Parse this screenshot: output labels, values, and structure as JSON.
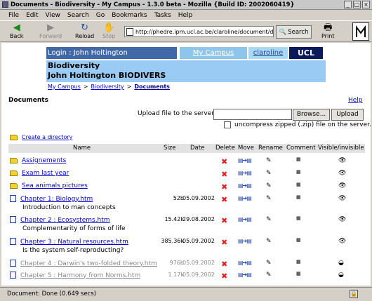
{
  "window": {
    "title": "Documents - Biodiversity - My Campus - 1.3.0 beta - Mozilla {Build ID: 2002060419}"
  },
  "menu": [
    "File",
    "Edit",
    "View",
    "Search",
    "Go",
    "Bookmarks",
    "Tasks",
    "Help"
  ],
  "toolbar": {
    "back": "Back",
    "forward": "Forward",
    "reload": "Reload",
    "stop": "Stop",
    "url": "http://phedre.ipm.ucl.ac.be/claroline/document/dc",
    "search": "Search",
    "print": "Print"
  },
  "banner": {
    "login": "Login : John Holtington",
    "campus": "My Campus",
    "claroline": "claroline",
    "ucl": "UCL"
  },
  "course": {
    "title": "Biodiversity",
    "subtitle": "John Holtington BIODIVERS"
  },
  "breadcrumb": [
    "My Campus",
    "Biodiversity",
    "Documents"
  ],
  "page": {
    "title": "Documents",
    "help": "Help"
  },
  "upload": {
    "label": "Upload file to the server :",
    "browse": "Browse...",
    "upload": "Upload",
    "uncompress": "uncompress zipped (.zip) file on the server."
  },
  "create_dir": "Create a directory",
  "table": {
    "headers": {
      "name": "Name",
      "size": "Size",
      "date": "Date",
      "delete": "Delete",
      "move": "Move",
      "rename": "Rename",
      "comment": "Comment",
      "visible": "Visible/invisible"
    },
    "rows": [
      {
        "name": "Assignements",
        "size": "",
        "date": "",
        "comment": ""
      },
      {
        "name": "Exam last year",
        "size": "",
        "date": "",
        "comment": ""
      },
      {
        "name": "Sea animals pictures",
        "size": "",
        "date": "",
        "comment": ""
      },
      {
        "name": "Chapter 1: Biology.htm",
        "size": "52b",
        "date": "05.09.2002",
        "comment": "Introduction to man concepts"
      },
      {
        "name": "Chapter 2 : Ecosystems.htm",
        "size": "15.42k",
        "date": "29.08.2002",
        "comment": "Complementarity of forms of life"
      },
      {
        "name": "Chapter 3 : Natural resources.htm",
        "size": "385.36k",
        "date": "05.09.2002",
        "comment": "Is the system self-reproducting?"
      },
      {
        "name": "Chapter 4 : Darwin's two-folded theory.htm",
        "size": "976b",
        "date": "05.09.2002",
        "comment": ""
      },
      {
        "name": "Chapter 5 : Harmony from Norms.htm",
        "size": "1.17k",
        "date": "05.09.2002",
        "comment": ""
      }
    ]
  },
  "status": "Document: Done (0.649 secs)"
}
